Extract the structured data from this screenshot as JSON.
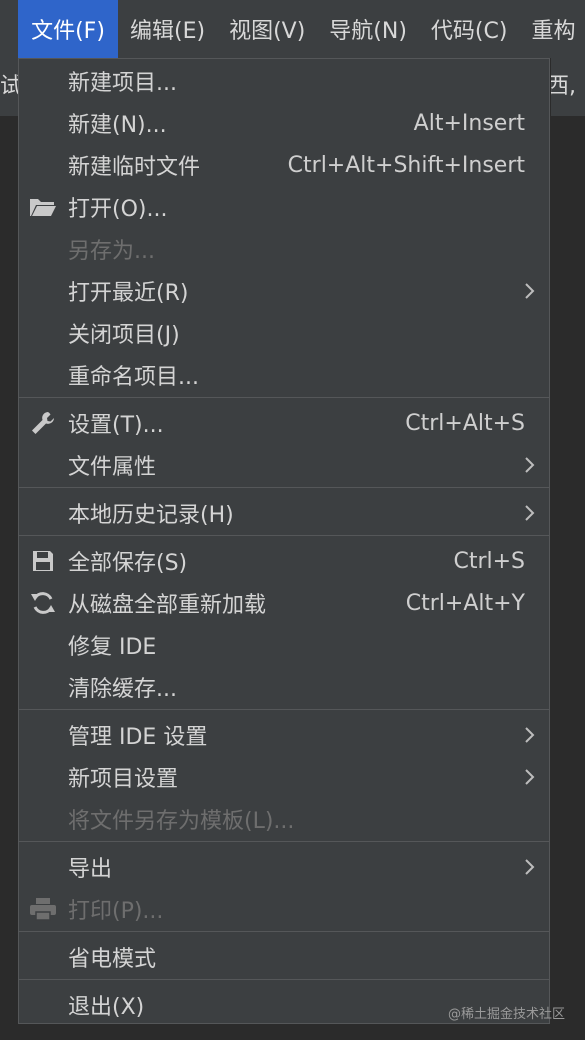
{
  "menubar": {
    "items": [
      "文件(F)",
      "编辑(E)",
      "视图(V)",
      "导航(N)",
      "代码(C)",
      "重构"
    ],
    "partial_left": "试",
    "partial_right": "西,"
  },
  "file_menu": {
    "items": [
      {
        "label": "新建项目...",
        "shortcut": "",
        "icon": "",
        "submenu": false,
        "disabled": false
      },
      {
        "label": "新建(N)...",
        "shortcut": "Alt+Insert",
        "icon": "",
        "submenu": false,
        "disabled": false
      },
      {
        "label": "新建临时文件",
        "shortcut": "Ctrl+Alt+Shift+Insert",
        "icon": "",
        "submenu": false,
        "disabled": false
      },
      {
        "label": "打开(O)...",
        "shortcut": "",
        "icon": "folder-open-icon",
        "submenu": false,
        "disabled": false
      },
      {
        "label": "另存为...",
        "shortcut": "",
        "icon": "",
        "submenu": false,
        "disabled": true
      },
      {
        "label": "打开最近(R)",
        "shortcut": "",
        "icon": "",
        "submenu": true,
        "disabled": false
      },
      {
        "label": "关闭项目(J)",
        "shortcut": "",
        "icon": "",
        "submenu": false,
        "disabled": false
      },
      {
        "label": "重命名项目...",
        "shortcut": "",
        "icon": "",
        "submenu": false,
        "disabled": false
      },
      {
        "label": "设置(T)...",
        "shortcut": "Ctrl+Alt+S",
        "icon": "wrench-icon",
        "submenu": false,
        "disabled": false
      },
      {
        "label": "文件属性",
        "shortcut": "",
        "icon": "",
        "submenu": true,
        "disabled": false
      },
      {
        "label": "本地历史记录(H)",
        "shortcut": "",
        "icon": "",
        "submenu": true,
        "disabled": false
      },
      {
        "label": "全部保存(S)",
        "shortcut": "Ctrl+S",
        "icon": "save-icon",
        "submenu": false,
        "disabled": false
      },
      {
        "label": "从磁盘全部重新加载",
        "shortcut": "Ctrl+Alt+Y",
        "icon": "reload-icon",
        "submenu": false,
        "disabled": false
      },
      {
        "label": "修复 IDE",
        "shortcut": "",
        "icon": "",
        "submenu": false,
        "disabled": false
      },
      {
        "label": "清除缓存...",
        "shortcut": "",
        "icon": "",
        "submenu": false,
        "disabled": false
      },
      {
        "label": "管理 IDE 设置",
        "shortcut": "",
        "icon": "",
        "submenu": true,
        "disabled": false
      },
      {
        "label": "新项目设置",
        "shortcut": "",
        "icon": "",
        "submenu": true,
        "disabled": false
      },
      {
        "label": "将文件另存为模板(L)...",
        "shortcut": "",
        "icon": "",
        "submenu": false,
        "disabled": true
      },
      {
        "label": "导出",
        "shortcut": "",
        "icon": "",
        "submenu": true,
        "disabled": false
      },
      {
        "label": "打印(P)...",
        "shortcut": "",
        "icon": "printer-icon",
        "submenu": false,
        "disabled": true
      },
      {
        "label": "省电模式",
        "shortcut": "",
        "icon": "",
        "submenu": false,
        "disabled": false
      },
      {
        "label": "退出(X)",
        "shortcut": "",
        "icon": "",
        "submenu": false,
        "disabled": false
      }
    ]
  },
  "watermark": "@稀土掘金技术社区",
  "colors": {
    "menu_bg": "#3c3f41",
    "active_menubar": "#2f65ca",
    "text": "#d4d4d4",
    "disabled_text": "#6e6e6e",
    "separator": "#555759"
  }
}
